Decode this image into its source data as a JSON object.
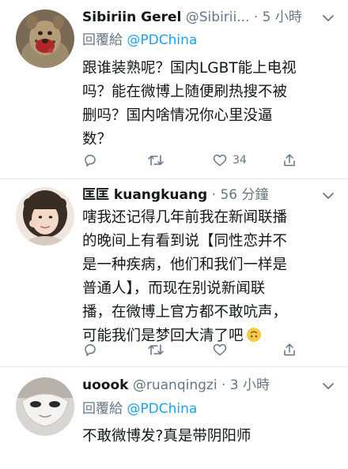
{
  "tweets": [
    {
      "name": "Sibiriin Gerel",
      "handle": "@Sibirii...",
      "separator": "·",
      "time": "5 小時",
      "replying_prefix": "回覆給 ",
      "replying_to": "@PDChina",
      "lines": [
        "跟谁装熟呢？国内LGBT能上电视",
        "吗？能在微博上随便刷热搜不被",
        "删吗？国内啥情况你心里没逼",
        "数？"
      ],
      "actions": {
        "reply": "",
        "retweet": "",
        "like": "34",
        "share": ""
      }
    },
    {
      "name": "匡匡 kuangkuang",
      "handle": "",
      "separator": "·",
      "time": "56 分鐘",
      "replying_prefix": "",
      "replying_to": "",
      "lines": [
        "嗐我还记得几年前我在新闻联播",
        "的晚间上有看到说【同性恋并不",
        "是一种疾病，他们和我们一样是",
        "普通人】，而现在别说新闻联",
        "播，在微博上官方都不敢吭声，",
        "可能我们是梦回大清了吧"
      ],
      "actions": {
        "reply": "",
        "retweet": "",
        "like": "",
        "share": ""
      }
    },
    {
      "name": "uoook",
      "handle": "@ruanqingzi",
      "separator": "·",
      "time": "3 小時",
      "replying_prefix": "回覆給 ",
      "replying_to": "@PDChina",
      "lines": [
        "不敢微博发?真是带阴阳师"
      ]
    }
  ],
  "icons": {
    "reply": "reply-icon",
    "retweet": "retweet-icon",
    "like": "heart-icon",
    "share": "share-icon",
    "more": "chevron-down-icon",
    "emoji": "upside-down-face-emoji-icon"
  },
  "colors": {
    "text": "#14171a",
    "secondary": "#657786",
    "link": "#1da1f2",
    "divider": "#e1e8ed"
  }
}
